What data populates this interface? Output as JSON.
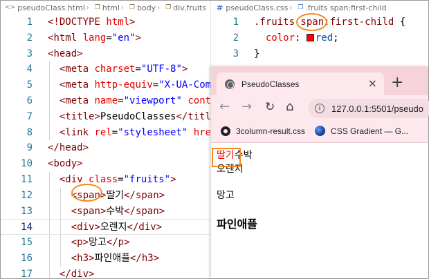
{
  "breadcrumb": {
    "file": "pseudoClass.html",
    "items": [
      "html",
      "body",
      "div.fruits"
    ]
  },
  "html_editor": {
    "lines": [
      {
        "n": "1",
        "tokens": [
          [
            "c-punc",
            "<!"
          ],
          [
            "c-doc",
            "DOCTYPE"
          ],
          [
            "c-text",
            " "
          ],
          [
            "c-attr",
            "html"
          ],
          [
            "c-punc",
            ">"
          ]
        ]
      },
      {
        "n": "2",
        "tokens": [
          [
            "c-punc",
            "<"
          ],
          [
            "c-tag",
            "html"
          ],
          [
            "c-text",
            " "
          ],
          [
            "c-attr",
            "lang"
          ],
          [
            "c-text",
            "="
          ],
          [
            "c-val",
            "\"en\""
          ],
          [
            "c-punc",
            ">"
          ]
        ]
      },
      {
        "n": "3",
        "tokens": [
          [
            "c-punc",
            "<"
          ],
          [
            "c-tag",
            "head"
          ],
          [
            "c-punc",
            ">"
          ]
        ]
      },
      {
        "n": "4",
        "tokens": [
          [
            "c-text",
            "  "
          ],
          [
            "c-punc",
            "<"
          ],
          [
            "c-tag",
            "meta"
          ],
          [
            "c-text",
            " "
          ],
          [
            "c-attr",
            "charset"
          ],
          [
            "c-text",
            "="
          ],
          [
            "c-val",
            "\"UTF-8\""
          ],
          [
            "c-punc",
            ">"
          ]
        ]
      },
      {
        "n": "5",
        "tokens": [
          [
            "c-text",
            "  "
          ],
          [
            "c-punc",
            "<"
          ],
          [
            "c-tag",
            "meta"
          ],
          [
            "c-text",
            " "
          ],
          [
            "c-attr",
            "http-equiv"
          ],
          [
            "c-text",
            "="
          ],
          [
            "c-val",
            "\"X-UA-Com"
          ]
        ]
      },
      {
        "n": "6",
        "tokens": [
          [
            "c-text",
            "  "
          ],
          [
            "c-punc",
            "<"
          ],
          [
            "c-tag",
            "meta"
          ],
          [
            "c-text",
            " "
          ],
          [
            "c-attr",
            "name"
          ],
          [
            "c-text",
            "="
          ],
          [
            "c-val",
            "\"viewport\""
          ],
          [
            "c-text",
            " "
          ],
          [
            "c-attr",
            "cont"
          ]
        ]
      },
      {
        "n": "7",
        "tokens": [
          [
            "c-text",
            "  "
          ],
          [
            "c-punc",
            "<"
          ],
          [
            "c-tag",
            "title"
          ],
          [
            "c-punc",
            ">"
          ],
          [
            "c-text",
            "PseudoClasses"
          ],
          [
            "c-punc",
            "</"
          ],
          [
            "c-tag",
            "titl"
          ]
        ]
      },
      {
        "n": "8",
        "tokens": [
          [
            "c-text",
            "  "
          ],
          [
            "c-punc",
            "<"
          ],
          [
            "c-tag",
            "link"
          ],
          [
            "c-text",
            " "
          ],
          [
            "c-attr",
            "rel"
          ],
          [
            "c-text",
            "="
          ],
          [
            "c-val",
            "\"stylesheet\""
          ],
          [
            "c-text",
            " "
          ],
          [
            "c-attr",
            "hre"
          ]
        ]
      },
      {
        "n": "9",
        "tokens": [
          [
            "c-punc",
            "</"
          ],
          [
            "c-tag",
            "head"
          ],
          [
            "c-punc",
            ">"
          ]
        ]
      },
      {
        "n": "10",
        "tokens": [
          [
            "c-punc",
            "<"
          ],
          [
            "c-tag",
            "body"
          ],
          [
            "c-punc",
            ">"
          ]
        ]
      },
      {
        "n": "11",
        "tokens": [
          [
            "c-text",
            "  "
          ],
          [
            "c-punc",
            "<"
          ],
          [
            "c-tag",
            "div"
          ],
          [
            "c-text",
            " "
          ],
          [
            "c-attr",
            "class"
          ],
          [
            "c-text",
            "="
          ],
          [
            "c-val",
            "\"fruits\""
          ],
          [
            "c-punc",
            ">"
          ]
        ]
      },
      {
        "n": "12",
        "tokens": [
          [
            "c-text",
            "    "
          ],
          [
            "c-punc",
            "<"
          ],
          [
            "c-tag",
            "span"
          ],
          [
            "c-punc",
            ">"
          ],
          [
            "c-text",
            "딸기"
          ],
          [
            "c-punc",
            "</"
          ],
          [
            "c-tag",
            "span"
          ],
          [
            "c-punc",
            ">"
          ]
        ]
      },
      {
        "n": "13",
        "tokens": [
          [
            "c-text",
            "    "
          ],
          [
            "c-punc",
            "<"
          ],
          [
            "c-tag",
            "span"
          ],
          [
            "c-punc",
            ">"
          ],
          [
            "c-text",
            "수박"
          ],
          [
            "c-punc",
            "</"
          ],
          [
            "c-tag",
            "span"
          ],
          [
            "c-punc",
            ">"
          ]
        ]
      },
      {
        "n": "14",
        "tokens": [
          [
            "c-text",
            "    "
          ],
          [
            "c-punc",
            "<"
          ],
          [
            "c-tag",
            "div"
          ],
          [
            "c-punc",
            ">"
          ],
          [
            "c-text",
            "오렌지"
          ],
          [
            "c-punc",
            "</"
          ],
          [
            "c-tag",
            "div"
          ],
          [
            "c-punc",
            ">"
          ]
        ]
      },
      {
        "n": "15",
        "tokens": [
          [
            "c-text",
            "    "
          ],
          [
            "c-punc",
            "<"
          ],
          [
            "c-tag",
            "p"
          ],
          [
            "c-punc",
            ">"
          ],
          [
            "c-text",
            "망고"
          ],
          [
            "c-punc",
            "</"
          ],
          [
            "c-tag",
            "p"
          ],
          [
            "c-punc",
            ">"
          ]
        ]
      },
      {
        "n": "16",
        "tokens": [
          [
            "c-text",
            "    "
          ],
          [
            "c-punc",
            "<"
          ],
          [
            "c-tag",
            "h3"
          ],
          [
            "c-punc",
            ">"
          ],
          [
            "c-text",
            "파인애플"
          ],
          [
            "c-punc",
            "</"
          ],
          [
            "c-tag",
            "h3"
          ],
          [
            "c-punc",
            ">"
          ]
        ]
      },
      {
        "n": "17",
        "tokens": [
          [
            "c-text",
            "  "
          ],
          [
            "c-punc",
            "</"
          ],
          [
            "c-tag",
            "div"
          ],
          [
            "c-punc",
            ">"
          ]
        ]
      }
    ],
    "current_line": "14"
  },
  "css_editor": {
    "breadcrumb_file": "pseudoClass.css",
    "breadcrumb_rule": ".fruits span:first-child",
    "lines": [
      {
        "n": "1",
        "tokens": [
          [
            "c-sel",
            ".fruits span:first-child"
          ],
          [
            "c-text",
            " {"
          ]
        ]
      },
      {
        "n": "2",
        "tokens": [
          [
            "c-text",
            "  "
          ],
          [
            "c-prop",
            "color"
          ],
          [
            "c-text",
            ": "
          ],
          [
            "swatch",
            ""
          ],
          [
            "c-cval",
            "red"
          ],
          [
            "c-text",
            ";"
          ]
        ]
      },
      {
        "n": "3",
        "tokens": [
          [
            "c-text",
            "}"
          ]
        ]
      }
    ]
  },
  "browser": {
    "tab_title": "PseudoClasses",
    "tab_close": "×",
    "new_tab": "+",
    "back": "←",
    "forward": "→",
    "reload": "↻",
    "home": "⌂",
    "info": "i",
    "url": "127.0.0.1:5501/pseudo",
    "bookmarks": [
      "3column-result.css",
      "CSS Gradient — G..."
    ],
    "page": {
      "first_span": "딸기",
      "second_span": "수박",
      "div_text": "오렌지",
      "p_text": "망고",
      "h3_text": "파인애플"
    }
  },
  "colors": {
    "highlight": "#f28a1e",
    "first_child_color": "#ff0000",
    "tab_strip": "#f6d3da"
  }
}
